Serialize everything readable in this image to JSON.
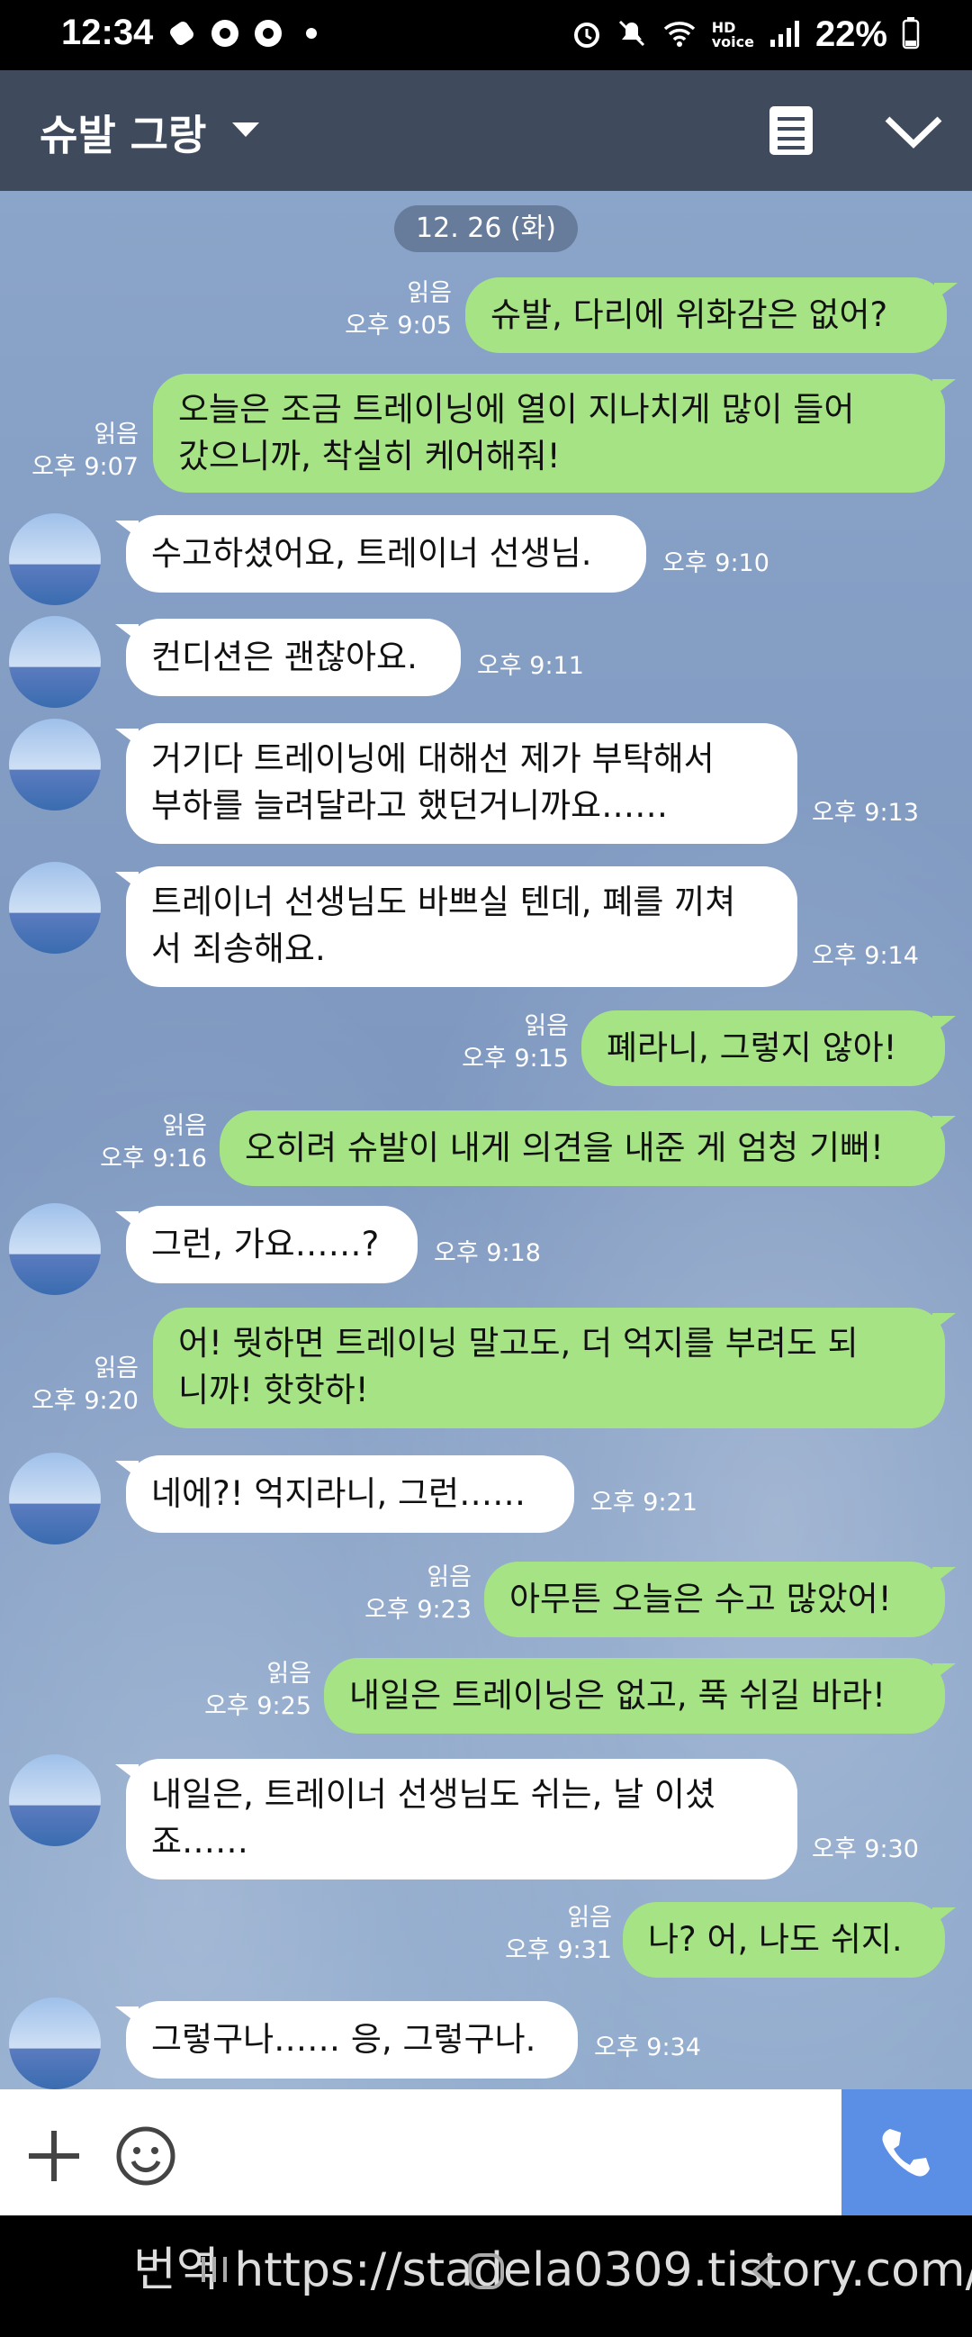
{
  "status_bar": {
    "time": "12:34",
    "battery": "22%"
  },
  "header": {
    "title": "슈발 그랑"
  },
  "date_divider": "12. 26 (화)",
  "messages": [
    {
      "text": "슈발, 다리에 위화감은 없어?",
      "read": "읽음",
      "time": "오후 9:05"
    },
    {
      "text": "오늘은 조금 트레이닝에 열이 지나치게 많이 들어 갔으니까, 착실히 케어해줘!",
      "read": "읽음",
      "time": "오후 9:07"
    },
    {
      "text": "수고하셨어요, 트레이너 선생님.",
      "time": "오후 9:10"
    },
    {
      "text": "컨디션은 괜찮아요.",
      "time": "오후 9:11"
    },
    {
      "text": "거기다 트레이닝에 대해선 제가 부탁해서 부하를 늘려달라고 했던거니까요……",
      "time": "오후 9:13"
    },
    {
      "text": "트레이너 선생님도 바쁘실 텐데, 폐를 끼쳐서 죄송해요.",
      "time": "오후 9:14"
    },
    {
      "text": "폐라니, 그렇지 않아!",
      "read": "읽음",
      "time": "오후 9:15"
    },
    {
      "text": "오히려 슈발이 내게 의견을 내준 게 엄청 기뻐!",
      "read": "읽음",
      "time": "오후 9:16"
    },
    {
      "text": "그런, 가요……?",
      "time": "오후 9:18"
    },
    {
      "text": "어! 뭣하면 트레이닝 말고도, 더 억지를 부려도 되니까! 핫핫하!",
      "read": "읽음",
      "time": "오후 9:20"
    },
    {
      "text": "네에?! 억지라니, 그런……",
      "time": "오후 9:21"
    },
    {
      "text": "아무튼 오늘은 수고 많았어!",
      "read": "읽음",
      "time": "오후 9:23"
    },
    {
      "text": "내일은 트레이닝은 없고, 푹 쉬길 바라!",
      "read": "읽음",
      "time": "오후 9:25"
    },
    {
      "text": "내일은, 트레이너 선생님도 쉬는, 날 이셨죠……",
      "time": "오후 9:30"
    },
    {
      "text": "나? 어, 나도 쉬지.",
      "read": "읽음",
      "time": "오후 9:31"
    },
    {
      "text": "그렇구나…… 응, 그렇구나.",
      "time": "오후 9:34"
    }
  ],
  "lines": {
    "m2a": "오늘은 조금 트레이닝에 열이 지나치게 많이 들어",
    "m2b": "갔으니까, 착실히 케어해줘!",
    "m5a": "거기다 트레이닝에 대해선 제가 부탁해서",
    "m5b": "부하를 늘려달라고 했던거니까요……",
    "m6a": "트레이너 선생님도 바쁘실 텐데, 폐를 끼쳐",
    "m6b": "서 죄송해요.",
    "m10a": "어! 뭣하면 트레이닝 말고도, 더 억지를 부려도 되",
    "m10b": "니까! 핫핫하!",
    "m14a": "내일은, 트레이너 선생님도 쉬는, 날 이셨",
    "m14b": "죠……"
  },
  "watermark": "번역 https://stadela0309.tistory.com/",
  "colors": {
    "my_bubble": "#a6e385",
    "their_bubble": "#ffffff",
    "header": "#3f4a5c",
    "call_button": "#5b8fe6"
  }
}
